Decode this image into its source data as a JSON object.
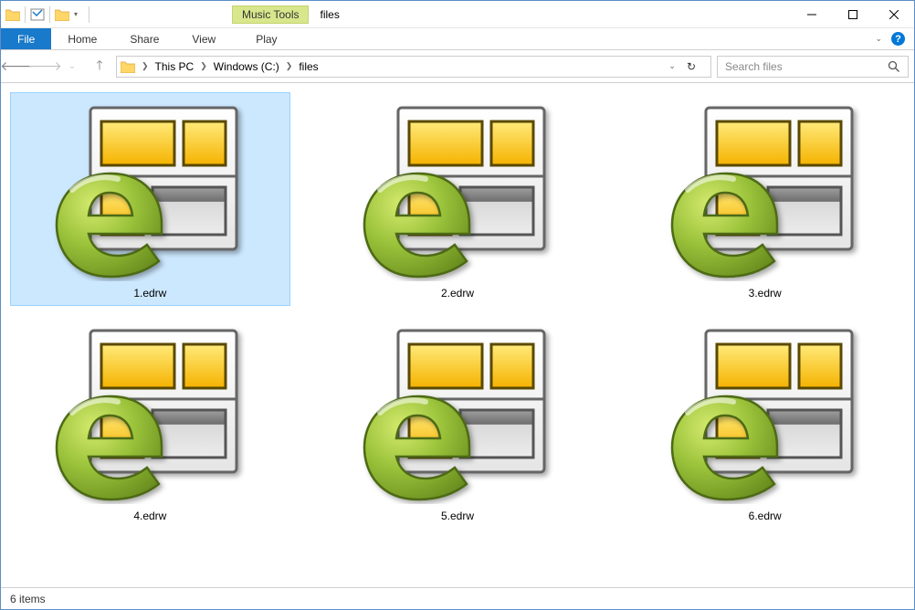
{
  "window": {
    "title": "files",
    "tool_tab": "Music Tools"
  },
  "ribbon": {
    "file": "File",
    "home": "Home",
    "share": "Share",
    "view": "View",
    "play": "Play"
  },
  "breadcrumb": {
    "seg1": "This PC",
    "seg2": "Windows (C:)",
    "seg3": "files"
  },
  "search": {
    "placeholder": "Search files"
  },
  "files": [
    {
      "name": "1.edrw"
    },
    {
      "name": "2.edrw"
    },
    {
      "name": "3.edrw"
    },
    {
      "name": "4.edrw"
    },
    {
      "name": "5.edrw"
    },
    {
      "name": "6.edrw"
    }
  ],
  "status": "6 items"
}
